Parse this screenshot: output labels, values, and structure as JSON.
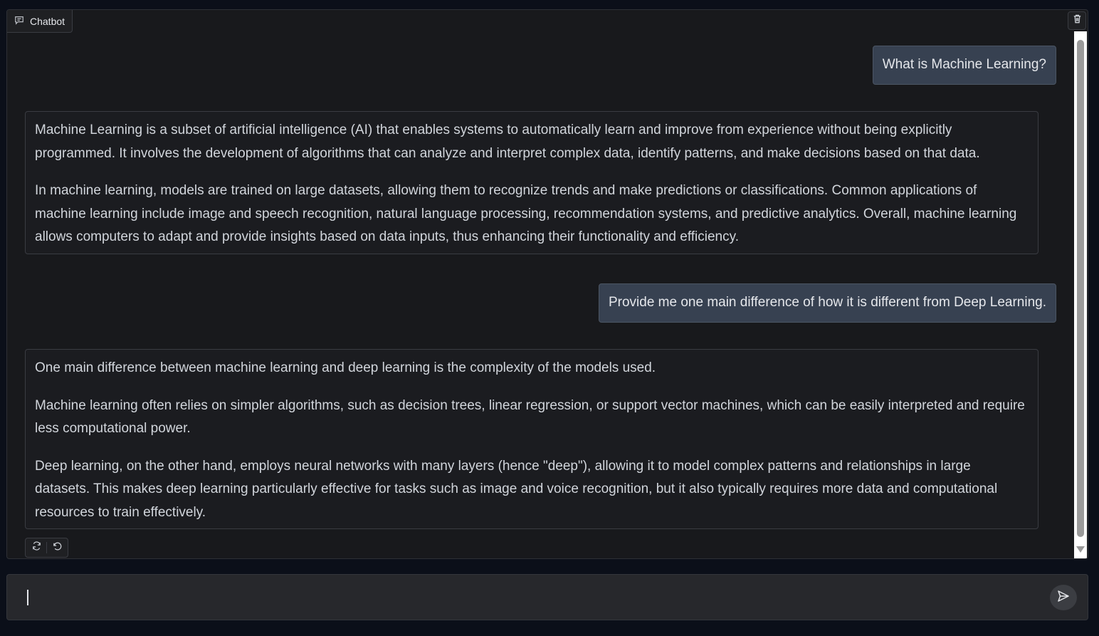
{
  "chatbot": {
    "label": "Chatbot",
    "messages": [
      {
        "role": "user",
        "text": "What is Machine Learning?"
      },
      {
        "role": "bot",
        "paragraphs": [
          "Machine Learning is a subset of artificial intelligence (AI) that enables systems to automatically learn and improve from experience without being explicitly programmed. It involves the development of algorithms that can analyze and interpret complex data, identify patterns, and make decisions based on that data.",
          "In machine learning, models are trained on large datasets, allowing them to recognize trends and make predictions or classifications. Common applications of machine learning include image and speech recognition, natural language processing, recommendation systems, and predictive analytics. Overall, machine learning allows computers to adapt and provide insights based on data inputs, thus enhancing their functionality and efficiency."
        ]
      },
      {
        "role": "user",
        "text": "Provide me one main difference of how it is different from Deep Learning."
      },
      {
        "role": "bot",
        "paragraphs": [
          "One main difference between machine learning and deep learning is the complexity of the models used.",
          "Machine learning often relies on simpler algorithms, such as decision trees, linear regression, or support vector machines, which can be easily interpreted and require less computational power.",
          "Deep learning, on the other hand, employs neural networks with many layers (hence \"deep\"), allowing it to model complex patterns and relationships in large datasets. This makes deep learning particularly effective for tasks such as image and voice recognition, but it also typically requires more data and computational resources to train effectively."
        ]
      }
    ]
  },
  "input": {
    "value": "",
    "placeholder": ""
  },
  "icons": {
    "label_icon": "chat-icon",
    "clear": "trash-icon",
    "retry": "refresh-icon",
    "undo": "undo-icon",
    "send": "send-icon"
  },
  "colors": {
    "background": "#0b0f19",
    "panel": "#18191c",
    "user_bubble": "#374151",
    "text": "#d1d5db"
  }
}
